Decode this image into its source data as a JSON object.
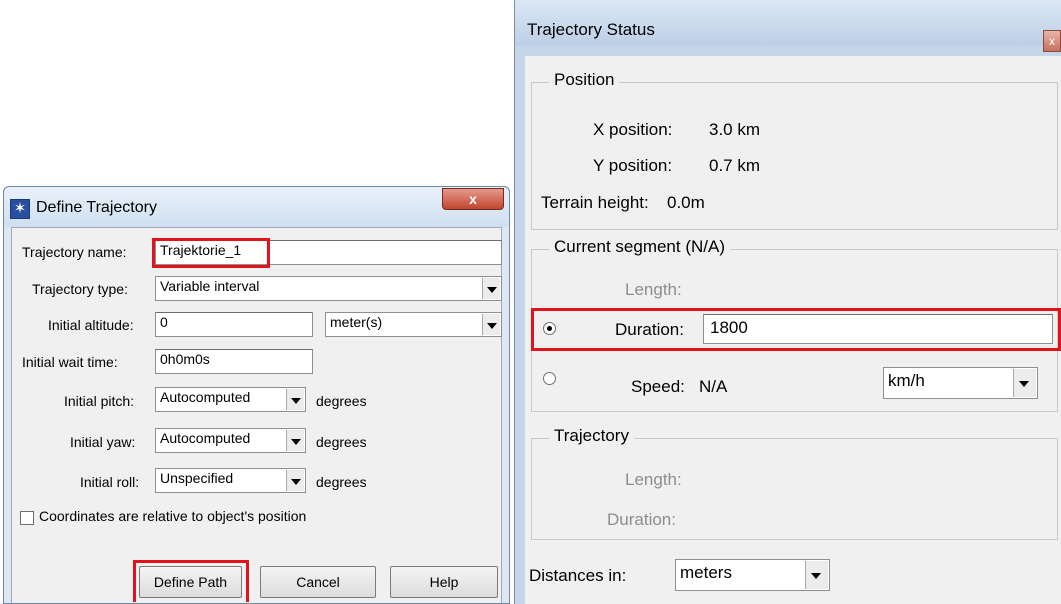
{
  "define_trajectory": {
    "title": "Define Trajectory",
    "close_label": "x",
    "name_label": "Trajectory name:",
    "name_value": "Trajektorie_1",
    "type_label": "Trajectory type:",
    "type_value": "Variable interval",
    "altitude_label": "Initial altitude:",
    "altitude_value": "0",
    "altitude_unit": "meter(s)",
    "wait_label": "Initial wait time:",
    "wait_value": "0h0m0s",
    "pitch_label": "Initial pitch:",
    "pitch_value": "Autocomputed",
    "pitch_unit": "degrees",
    "yaw_label": "Initial yaw:",
    "yaw_value": "Autocomputed",
    "yaw_unit": "degrees",
    "roll_label": "Initial roll:",
    "roll_value": "Unspecified",
    "roll_unit": "degrees",
    "relative_checkbox_label": "Coordinates are relative to object's position",
    "relative_checked": false,
    "buttons": {
      "define_path": "Define Path",
      "cancel": "Cancel",
      "help": "Help"
    }
  },
  "trajectory_status": {
    "title": "Trajectory Status",
    "position_group": "Position",
    "x_label": "X position:",
    "x_value": "3.0 km",
    "y_label": "Y position:",
    "y_value": "0.7 km",
    "terrain_label": "Terrain height:",
    "terrain_value": "0.0m",
    "segment_group": "Current segment (N/A)",
    "seg_length_label": "Length:",
    "duration_label": "Duration:",
    "duration_value": "1800",
    "duration_selected": true,
    "speed_label": "Speed:",
    "speed_value": "N/A",
    "speed_unit": "km/h",
    "trajectory_group": "Trajectory",
    "traj_length_label": "Length:",
    "traj_duration_label": "Duration:",
    "distances_label": "Distances in:",
    "distances_value": "meters"
  },
  "colors": {
    "highlight": "#e0141b",
    "title_bar": "#cfdff0"
  }
}
